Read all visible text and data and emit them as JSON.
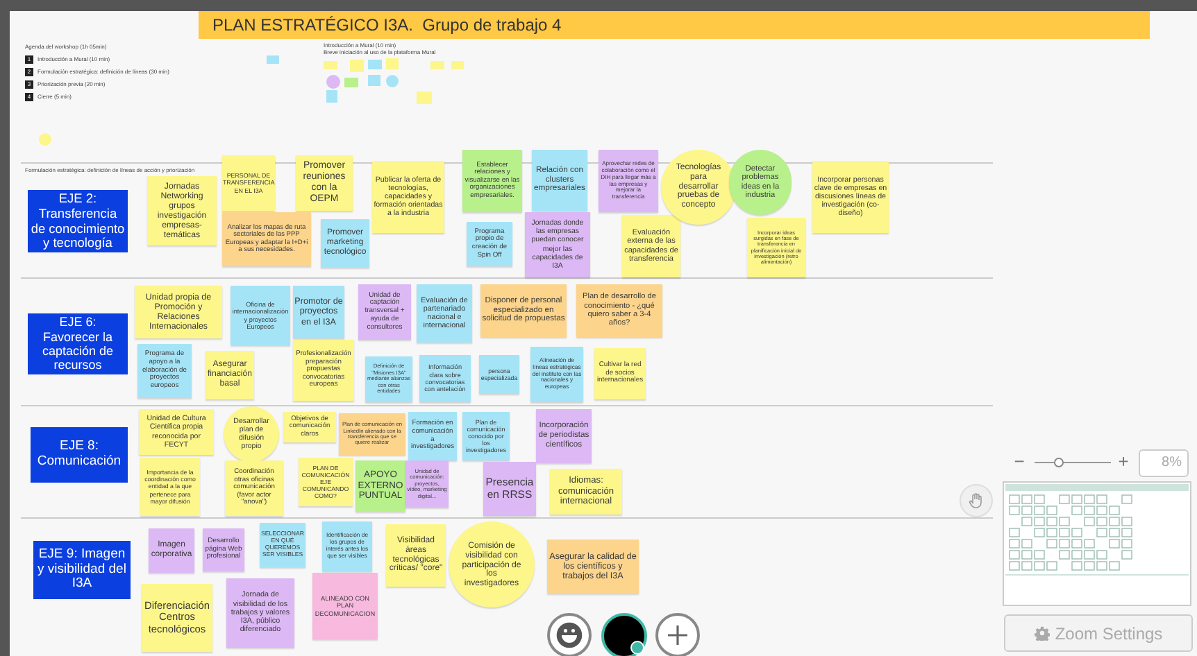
{
  "board": {
    "title": "PLAN ESTRATÉGICO I3A.  Grupo de trabajo 4",
    "agenda": {
      "heading": "Agenda del workshop (1h 05min)",
      "items": [
        {
          "number": "1",
          "text": "Introducción a Mural (10 min)"
        },
        {
          "number": "2",
          "text": "Formulación estratégica: definición de líneas (30 min)"
        },
        {
          "number": "3",
          "text": "Priorización previa (20 min)"
        },
        {
          "number": "4",
          "text": "Cierre (5 min)"
        }
      ]
    },
    "intro": {
      "heading": "Introducción a Mural (10 min)",
      "subtitle": "Breve iniciación al uso de la plataforma Mural"
    },
    "mini_notes": [
      {
        "kind": "note",
        "color": "#a5e4f7"
      },
      {
        "kind": "note",
        "color": "#fdf68a"
      },
      {
        "kind": "note",
        "color": "#fdf68a"
      },
      {
        "kind": "note",
        "color": "#a5e4f7"
      },
      {
        "kind": "note",
        "color": "#fdf68a"
      },
      {
        "kind": "note",
        "color": "#fdf68a"
      },
      {
        "kind": "note",
        "color": "#fdf68a"
      },
      {
        "kind": "circle",
        "color": "#dcb8f5"
      },
      {
        "kind": "note",
        "color": "#b8f08b"
      },
      {
        "kind": "note",
        "color": "#a5e4f7"
      },
      {
        "kind": "circle",
        "color": "#a5e4f7"
      },
      {
        "kind": "note",
        "color": "#a5e4f7"
      },
      {
        "kind": "note",
        "color": "#fdf68a"
      },
      {
        "kind": "circle",
        "color": "#fdf68a"
      }
    ],
    "lanes": [
      {
        "caption": "Formulación estratégica: definición de líneas de acción y priorización",
        "axis": "EJE 2: Transferencia de conocimiento y tecnología",
        "notes": [
          {
            "kind": "note",
            "color": "#fdf68a",
            "text": "Jornadas Networking grupos investigación empresas-temáticas"
          },
          {
            "kind": "note",
            "color": "#fdf68a",
            "text": "PERSONAL DE TRANSFERENCIA EN EL I3A"
          },
          {
            "kind": "note",
            "color": "#fdf68a",
            "text": "Promover reuniones con la OEPM"
          },
          {
            "kind": "note",
            "color": "#fcd48c",
            "text": "Analizar los mapas de ruta sectoriales de las PPP Europeas y adaptar la I+D+i a sus necesidades."
          },
          {
            "kind": "note",
            "color": "#a5e4f7",
            "text": "Promover marketing tecnológico"
          },
          {
            "kind": "note",
            "color": "#fdf68a",
            "text": "Publicar la oferta de tecnologías, capacidades y formación orientadas a la industria"
          },
          {
            "kind": "note",
            "color": "#b8f08b",
            "text": "Establecer relaciones y visualizarse en las organizaciones empresariales."
          },
          {
            "kind": "note",
            "color": "#a5e4f7",
            "text": "Programa propio de creación de Spin Off"
          },
          {
            "kind": "note",
            "color": "#a5e4f7",
            "text": "Relación con clusters empresariales"
          },
          {
            "kind": "note",
            "color": "#dcb8f5",
            "text": "Jornadas donde las empresas puedan conocer mejor las capacidades de I3A"
          },
          {
            "kind": "note",
            "color": "#dcb8f5",
            "text": "Aprovechar redes de colaboración como el DIH para llegar más a las empresas y mejorar la transferencia"
          },
          {
            "kind": "note",
            "color": "#fdf68a",
            "text": "Evaluación externa de las capacidades de transferencia"
          },
          {
            "kind": "circle",
            "color": "#fdf68a",
            "text": "Tecnologías para desarrollar pruebas de concepto"
          },
          {
            "kind": "circle",
            "color": "#b8f08b",
            "text": "Detectar problemas ideas en la industria"
          },
          {
            "kind": "note",
            "color": "#fdf68a",
            "text": "Incorporar ideas surgidas en fase de transferencia en planificación inicial de investigación (retro alimentación)"
          },
          {
            "kind": "note",
            "color": "#fdf68a",
            "text": "Incorporar personas clave de empresas en discusiones líneas de investigación (co-diseño)"
          }
        ]
      },
      {
        "axis": "EJE 6: Favorecer la captación de recursos",
        "notes": [
          {
            "kind": "note",
            "color": "#fdf68a",
            "text": "Unidad propia de Promoción y Relaciones Internacionales"
          },
          {
            "kind": "note",
            "color": "#a5e4f7",
            "text": "Oficina de internacionalización y proyectos Europeos"
          },
          {
            "kind": "note",
            "color": "#a5e4f7",
            "text": "Promotor de proyectos en el I3A"
          },
          {
            "kind": "note",
            "color": "#dcb8f5",
            "text": "Unidad de captación transversal + ayuda de consultores"
          },
          {
            "kind": "note",
            "color": "#a5e4f7",
            "text": "Evaluación de partenariado nacional e internacional"
          },
          {
            "kind": "note",
            "color": "#fcd48c",
            "text": "Disponer de personal especializado en solicitud de propuestas"
          },
          {
            "kind": "note",
            "color": "#fcd48c",
            "text": "Plan de desarrollo de conocimiento - ¿qué quiero saber a 3-4 años?"
          },
          {
            "kind": "note",
            "color": "#a5e4f7",
            "text": "Programa de apoyo a la elaboración de proyectos europeos"
          },
          {
            "kind": "note",
            "color": "#fdf68a",
            "text": "Asegurar financiación basal"
          },
          {
            "kind": "note",
            "color": "#fdf68a",
            "text": "Profesionalización preparación propuestas convocatorias europeas"
          },
          {
            "kind": "note",
            "color": "#a5e4f7",
            "text": "Definición de \"Misiones I3A\" mediante alianzas con otras entidades"
          },
          {
            "kind": "note",
            "color": "#a5e4f7",
            "text": "Información clara sobre convocatorias con antelación"
          },
          {
            "kind": "note",
            "color": "#a5e4f7",
            "text": "persona especializada"
          },
          {
            "kind": "note",
            "color": "#a5e4f7",
            "text": "Alineación de líneas estratégicas del instituto con las nacionales y europeas"
          },
          {
            "kind": "note",
            "color": "#fdf68a",
            "text": "Cultivar la red de socios internacionales"
          }
        ]
      },
      {
        "axis": "EJE 8: Comunicación",
        "notes": [
          {
            "kind": "note",
            "color": "#fdf68a",
            "text": "Unidad de Cultura Científica propia reconocida por FECYT"
          },
          {
            "kind": "circle",
            "color": "#fdf68a",
            "text": "Desarrollar plan de difusión propio"
          },
          {
            "kind": "note",
            "color": "#fdf68a",
            "text": "Objetivos de comunicación claros"
          },
          {
            "kind": "note",
            "color": "#fcd48c",
            "text": "Plan de comunicación en LinkedIn alienado con la transferencia que se quiere realizar"
          },
          {
            "kind": "note",
            "color": "#a5e4f7",
            "text": "Formación en comunicación a investigadores"
          },
          {
            "kind": "note",
            "color": "#a5e4f7",
            "text": "Plan de comunicación conocido por los investigadores"
          },
          {
            "kind": "note",
            "color": "#dcb8f5",
            "text": "Incorporación de periodistas científicos"
          },
          {
            "kind": "note",
            "color": "#fdf68a",
            "text": "Importancia de la coordinación como entidad a la que pertenece para mayor difusión"
          },
          {
            "kind": "note",
            "color": "#fdf68a",
            "text": "Coordinación otras oficinas comunicación (favor actor \"anova\")"
          },
          {
            "kind": "note",
            "color": "#fdf68a",
            "text": "PLAN DE COMUNICACIÓN EJE COMUNICANDO COMO?"
          },
          {
            "kind": "note",
            "color": "#b8f08b",
            "text": "APOYO EXTERNO PUNTUAL"
          },
          {
            "kind": "note",
            "color": "#dcb8f5",
            "text": "Unidad de comunicación: proyectos, vídeo, marketing digital..."
          },
          {
            "kind": "note",
            "color": "#dcb8f5",
            "text": "Presencia en RRSS"
          },
          {
            "kind": "note",
            "color": "#fdf68a",
            "text": "Idiomas: comunicación internacional"
          }
        ]
      },
      {
        "axis": "EJE 9: Imagen y visibilidad del I3A",
        "notes": [
          {
            "kind": "note",
            "color": "#dcb8f5",
            "text": "Imagen corporativa"
          },
          {
            "kind": "note",
            "color": "#dcb8f5",
            "text": "Desarrollo página Web profesional"
          },
          {
            "kind": "note",
            "color": "#a5e4f7",
            "text": "SELECCIONAR EN QUÉ QUEREMOS SER VISIBLES"
          },
          {
            "kind": "note",
            "color": "#a5e4f7",
            "text": "Identificación de los grupos de interés antes los que ser visibles"
          },
          {
            "kind": "note",
            "color": "#fdf68a",
            "text": "Visibilidad áreas tecnológicas críticas/ \"core\""
          },
          {
            "kind": "circle",
            "color": "#fdf68a",
            "text": "Comisión de visibilidad con participación de los investigadores"
          },
          {
            "kind": "note",
            "color": "#fcd48c",
            "text": "Asegurar la calidad de los científicos y trabajos del I3A"
          },
          {
            "kind": "note",
            "color": "#fdf68a",
            "text": "Diferenciación Centros tecnológicos"
          },
          {
            "kind": "note",
            "color": "#dcb8f5",
            "text": "Jornada de visibilidad de los trabajos y valores I3A, público diferenciado"
          },
          {
            "kind": "note",
            "color": "#f7b9de",
            "text": "ALINEADO CON PLAN DECOMUNICACION"
          }
        ]
      }
    ]
  },
  "zoom": {
    "minus": "−",
    "plus": "+",
    "level": 0.3,
    "reading": "8%"
  },
  "zoom_settings": "Zoom Settings"
}
